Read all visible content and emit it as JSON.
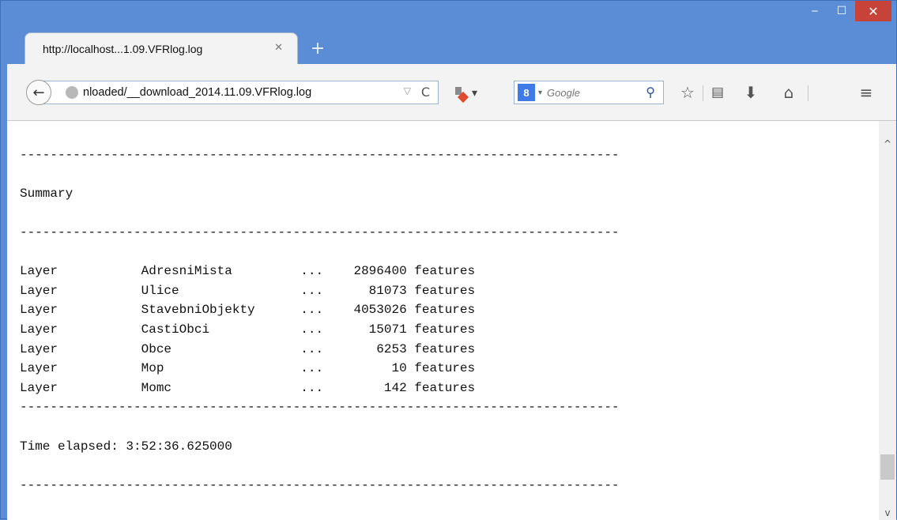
{
  "window": {
    "controls": {
      "minimize": "‒",
      "maximize": "☐",
      "close": "✕"
    }
  },
  "tab": {
    "title": "http://localhost...1.09.VFRlog.log",
    "close": "✕",
    "new_tab": "+"
  },
  "navbar": {
    "back": "←",
    "url": "nloaded/__download_2014.11.09.VFRlog.log",
    "url_dropdown": "▽",
    "reload": "C",
    "search_engine_letter": "8",
    "search_caret": "▾",
    "search_placeholder": "Google",
    "search_icon": "⚲",
    "icons": [
      "download-addon-icon",
      "bookmark-star-icon",
      "reading-list-icon",
      "downloads-icon",
      "home-icon",
      "menu-icon"
    ]
  },
  "log": {
    "lines": [
      "",
      "-------------------------------------------------------------------------------",
      "",
      "Summary",
      "",
      "-------------------------------------------------------------------------------",
      "",
      "Layer           AdresniMista         ...    2896400 features",
      "Layer           Ulice                ...      81073 features",
      "Layer           StavebniObjekty      ...    4053026 features",
      "Layer           CastiObci            ...      15071 features",
      "Layer           Obce                 ...       6253 features",
      "Layer           Mop                  ...         10 features",
      "Layer           Momc                 ...        142 features",
      "-------------------------------------------------------------------------------",
      "",
      "Time elapsed: 3:52:36.625000",
      "",
      "-------------------------------------------------------------------------------"
    ]
  },
  "scrollbar": {
    "up": "^",
    "down": "v",
    "position": 0.92
  }
}
